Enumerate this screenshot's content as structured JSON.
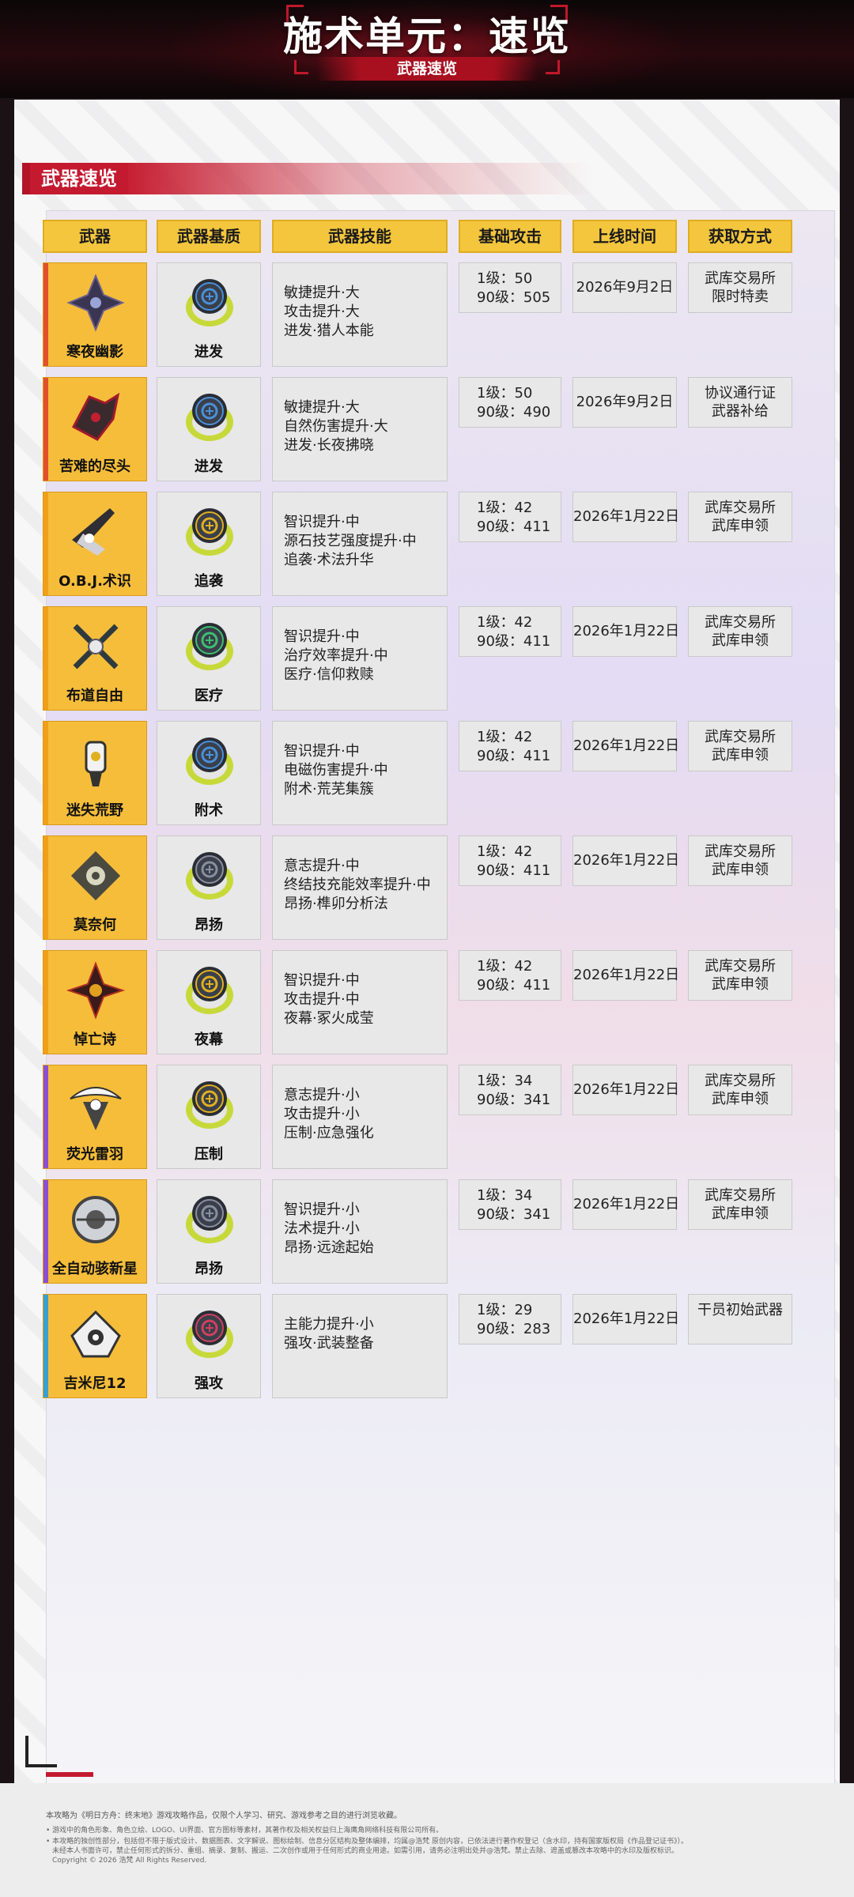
{
  "header": {
    "title": "施术单元：速览",
    "subtitle": "武器速览"
  },
  "section": {
    "label": "武器速览"
  },
  "table": {
    "headers": [
      "武器",
      "武器基质",
      "武器技能",
      "基础攻击",
      "上线时间",
      "获取方式"
    ],
    "rows": [
      {
        "weapon": "寒夜幽影",
        "accent": "#e0502a",
        "weapon_icon": "dark-shuriken-weapon-icon",
        "base": "进发",
        "orb_color": "#4a90d9",
        "orb_icon": "advance-glyph-icon",
        "skills": [
          "敏捷提升·大",
          "攻击提升·大",
          "进发·猎人本能"
        ],
        "atk": [
          "1级：50",
          "90级：505"
        ],
        "date": "2026年9月2日",
        "source": [
          "武库交易所",
          "限时特卖"
        ]
      },
      {
        "weapon": "苦难的尽头",
        "accent": "#e0502a",
        "weapon_icon": "red-blade-weapon-icon",
        "base": "进发",
        "orb_color": "#4a90d9",
        "orb_icon": "advance-glyph-icon",
        "skills": [
          "敏捷提升·大",
          "自然伤害提升·大",
          "进发·长夜拂晓"
        ],
        "atk": [
          "1级：50",
          "90级：490"
        ],
        "date": "2026年9月2日",
        "source": [
          "协议通行证",
          "武器补给"
        ]
      },
      {
        "weapon": "O.B.J.术识",
        "accent": "#f0a018",
        "weapon_icon": "lance-weapon-icon",
        "base": "追袭",
        "orb_color": "#e0b020",
        "orb_icon": "pursuit-glyph-icon",
        "skills": [
          "智识提升·中",
          "源石技艺强度提升·中",
          "追袭·术法升华"
        ],
        "atk": [
          "1级：42",
          "90级：411"
        ],
        "date": "2026年1月22日",
        "source": [
          "武库交易所",
          "武库申领"
        ]
      },
      {
        "weapon": "布道自由",
        "accent": "#f0a018",
        "weapon_icon": "staff-weapon-icon",
        "base": "医疗",
        "orb_color": "#3cc070",
        "orb_icon": "medical-glyph-icon",
        "skills": [
          "智识提升·中",
          "治疗效率提升·中",
          "医疗·信仰救赎"
        ],
        "atk": [
          "1级：42",
          "90级：411"
        ],
        "date": "2026年1月22日",
        "source": [
          "武库交易所",
          "武库申领"
        ]
      },
      {
        "weapon": "迷失荒野",
        "accent": "#f0a018",
        "weapon_icon": "lantern-weapon-icon",
        "base": "附术",
        "orb_color": "#4a90d9",
        "orb_icon": "enchant-glyph-icon",
        "skills": [
          "智识提升·中",
          "电磁伤害提升·中",
          "附术·荒芜集簇"
        ],
        "atk": [
          "1级：42",
          "90级：411"
        ],
        "date": "2026年1月22日",
        "source": [
          "武库交易所",
          "武库申领"
        ]
      },
      {
        "weapon": "莫奈何",
        "accent": "#f0a018",
        "weapon_icon": "gear-weapon-icon",
        "base": "昂扬",
        "orb_color": "#8a8fa0",
        "orb_icon": "uplift-glyph-icon",
        "skills": [
          "意志提升·中",
          "终结技充能效率提升·中",
          "昂扬·榫卯分析法"
        ],
        "atk": [
          "1级：42",
          "90级：411"
        ],
        "date": "2026年1月22日",
        "source": [
          "武库交易所",
          "武库申领"
        ]
      },
      {
        "weapon": "悼亡诗",
        "accent": "#f0a018",
        "weapon_icon": "elegy-weapon-icon",
        "base": "夜幕",
        "orb_color": "#e0b020",
        "orb_icon": "nightfall-glyph-icon",
        "skills": [
          "智识提升·中",
          "攻击提升·中",
          "夜幕·冢火成莹"
        ],
        "atk": [
          "1级：42",
          "90级：411"
        ],
        "date": "2026年1月22日",
        "source": [
          "武库交易所",
          "武库申领"
        ]
      },
      {
        "weapon": "荧光雷羽",
        "accent": "#8a50d0",
        "weapon_icon": "feather-weapon-icon",
        "base": "压制",
        "orb_color": "#e0b020",
        "orb_icon": "suppress-glyph-icon",
        "skills": [
          "意志提升·小",
          "攻击提升·小",
          "压制·应急强化"
        ],
        "atk": [
          "1级：34",
          "90级：341"
        ],
        "date": "2026年1月22日",
        "source": [
          "武库交易所",
          "武库申领"
        ]
      },
      {
        "weapon": "全自动骇新星",
        "accent": "#8a50d0",
        "weapon_icon": "orb-device-weapon-icon",
        "base": "昂扬",
        "orb_color": "#8a8fa0",
        "orb_icon": "uplift-glyph-icon",
        "skills": [
          "智识提升·小",
          "法术提升·小",
          "昂扬·远途起始"
        ],
        "atk": [
          "1级：34",
          "90级：341"
        ],
        "date": "2026年1月22日",
        "source": [
          "武库交易所",
          "武库申领"
        ]
      },
      {
        "weapon": "吉米尼12",
        "accent": "#3aa0d0",
        "weapon_icon": "gemini-weapon-icon",
        "base": "强攻",
        "orb_color": "#d04060",
        "orb_icon": "assault-glyph-icon",
        "skills": [
          "主能力提升·小",
          "强攻·武装整备"
        ],
        "atk": [
          "1级：29",
          "90级：283"
        ],
        "date": "2026年1月22日",
        "source": [
          "干员初始武器"
        ]
      }
    ]
  },
  "footer": {
    "line1": "本攻略为《明日方舟：终末地》游戏攻略作品，仅限个人学习、研究、游戏参考之目的进行浏览收藏。",
    "line2": "• 游戏中的角色形象、角色立绘、LOGO、UI界面、官方图标等素材，其著作权及相关权益归上海鹰角网络科技有限公司所有。",
    "line3": "• 本攻略的独创性部分，包括但不限于版式设计、数据图表、文字解说、图标绘制、信息分区结构及整体编排，均属@浩梵 原创内容，已依法进行著作权登记（含水印，持有国家版权局《作品登记证书》）。",
    "line4": "未经本人书面许可，禁止任何形式的拆分、重组、摘录、复制、搬运、二次创作或用于任何形式的商业用途。如需引用，请务必注明出处并@浩梵。禁止去除、遮盖或篡改本攻略中的水印及版权标识。",
    "line5": "Copyright © 2026 浩梵 All Rights Reserved."
  }
}
